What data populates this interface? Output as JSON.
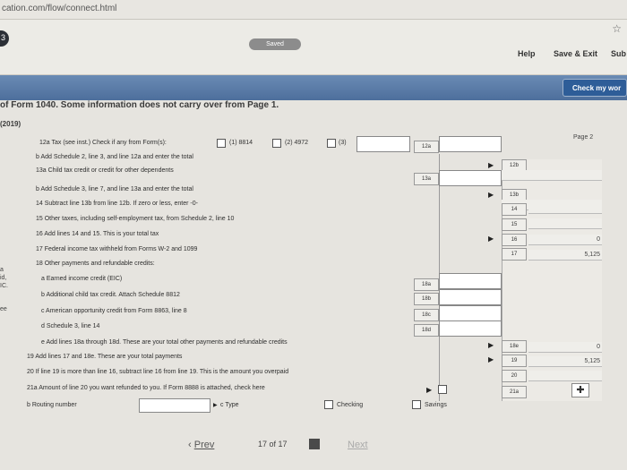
{
  "browser": {
    "url": "cation.com/flow/connect.html"
  },
  "header": {
    "saved": "Saved",
    "step_number": "3",
    "help": "Help",
    "save_exit": "Save & Exit",
    "sub": "Sub",
    "check": "Check my wor"
  },
  "form": {
    "notice": "of Form 1040. Some information does not carry over from Page 1.",
    "year": "(2019)",
    "page_label": "Page 2",
    "line12a": "12a Tax (see inst.) Check if any from Form(s):",
    "opt1": "(1) 8814",
    "opt2": "(2) 4972",
    "opt3": "(3)",
    "line12b": "b Add Schedule 2, line 3, and line 12a and enter the total",
    "line13a": "13a Child tax credit or credit for other dependents",
    "line13b": "b Add Schedule 3, line 7, and line 13a and enter the total",
    "line14": "14 Subtract line 13b from line 12b. If zero or less, enter -0-",
    "line15": "15 Other taxes, including self-employment tax, from Schedule 2, line 10",
    "line16": "16 Add lines 14 and 15. This is your total tax",
    "line17": "17 Federal income tax withheld from Forms W-2 and 1099",
    "line18": "18 Other payments and refundable credits:",
    "line18a": "a Earned income credit (EIC)",
    "line18b": "b Additional child tax credit. Attach Schedule 8812",
    "line18c": "c American opportunity credit from Form 8863, line 8",
    "line18d": "d Schedule 3, line 14",
    "line18e": "e Add lines 18a through 18d. These are your total other payments and refundable credits",
    "line19": "19 Add lines 17 and 18e. These are your total payments",
    "line20": "20 If line 19 is more than line 16, subtract line 16 from line 19. This is the amount you overpaid",
    "line21a": "21a Amount of line 20 you want refunded to you. If Form 8888 is attached, check here",
    "line21b": "b Routing number",
    "type": "c Type",
    "checking": "Checking",
    "savings": "Savings",
    "codes": {
      "c12a": "12a",
      "c12b": "12b",
      "c13a": "13a",
      "c13b": "13b",
      "c14": "14",
      "c15": "15",
      "c16": "16",
      "c17": "17",
      "c18a": "18a",
      "c18b": "18b",
      "c18c": "18c",
      "c18d": "18d",
      "c18e": "18e",
      "c19": "19",
      "c20": "20",
      "c21a": "21a"
    },
    "values": {
      "v16": "0",
      "v17": "5,125",
      "v18e": "0",
      "v19": "5,125"
    },
    "leftnotes": {
      "a": "a",
      "b": "id,",
      "c": "IC.",
      "d": "ee"
    }
  },
  "footer": {
    "prev": "Prev",
    "page_of": "17 of 17",
    "next": "Next"
  }
}
